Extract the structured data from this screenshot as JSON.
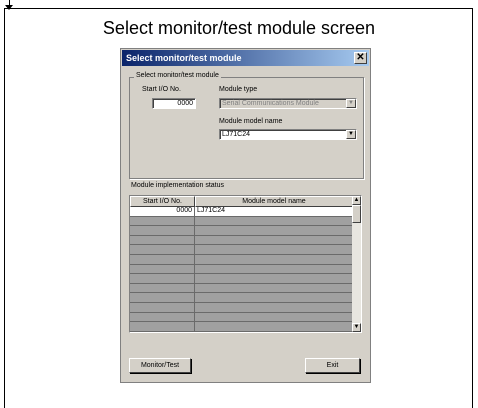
{
  "caption": "Select monitor/test module screen",
  "dialog": {
    "title": "Select monitor/test module",
    "close_glyph": "✕",
    "group": {
      "legend": "Select monitor/test module",
      "start_io_label": "Start I/O No.",
      "start_io_value": "0000",
      "module_type_label": "Module type",
      "module_type_value": "Serial Communications Module",
      "module_model_label": "Module model name",
      "module_model_value": "LJ71C24",
      "dropdown_glyph": "▼"
    },
    "status": {
      "label": "Module implementation status",
      "columns": [
        "Start I/O No.",
        "Module model name"
      ],
      "rows": [
        {
          "start_io": "0000",
          "model": "LJ71C24"
        }
      ],
      "empty_rows": 12,
      "scroll_up_glyph": "▲",
      "scroll_down_glyph": "▼"
    },
    "buttons": {
      "monitor_test": "Monitor/Test",
      "exit": "Exit"
    }
  }
}
